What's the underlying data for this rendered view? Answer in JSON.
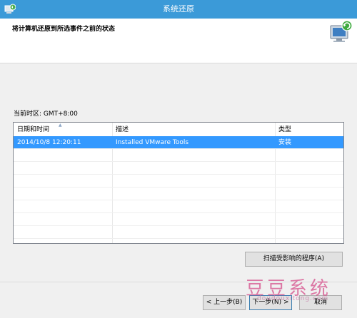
{
  "window": {
    "title": "系统还原"
  },
  "header": {
    "title": "将计算机还原到所选事件之前的状态"
  },
  "timezone": {
    "label": "当前时区: GMT+8:00"
  },
  "list": {
    "columns": [
      "日期和时间",
      "描述",
      "类型"
    ],
    "rows": [
      {
        "date": "2014/10/8 12:20:11",
        "description": "Installed VMware Tools",
        "type": "安装",
        "selected": true
      }
    ]
  },
  "buttons": {
    "scan": "扫描受影响的程序(A)",
    "back": "< 上一步(B)",
    "next": "下一步(N) >",
    "cancel": "取消"
  },
  "watermark": {
    "text": "豆豆系统",
    "url": "doudouxitong.com"
  },
  "colors": {
    "titlebar": "#3b9ad8",
    "selection": "#3399ff"
  }
}
